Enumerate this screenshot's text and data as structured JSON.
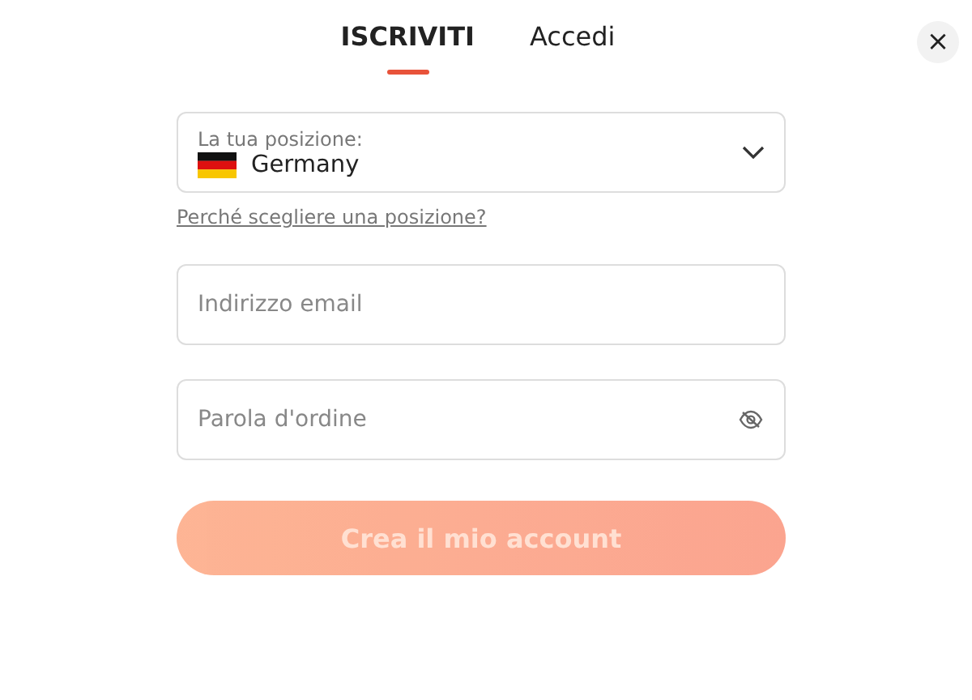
{
  "tabs": [
    {
      "label": "ISCRIVITI",
      "selected": true
    },
    {
      "label": "Accedi",
      "selected": false
    }
  ],
  "close_button": "×",
  "location": {
    "label": "La tua posizione:",
    "value": "Germany"
  },
  "location_help_link": "Perché scegliere una posizione?",
  "email": {
    "placeholder": "Indirizzo email"
  },
  "password": {
    "placeholder": "Parola d'ordine"
  },
  "submit": {
    "label": "Crea il mio account",
    "disabled": true
  }
}
